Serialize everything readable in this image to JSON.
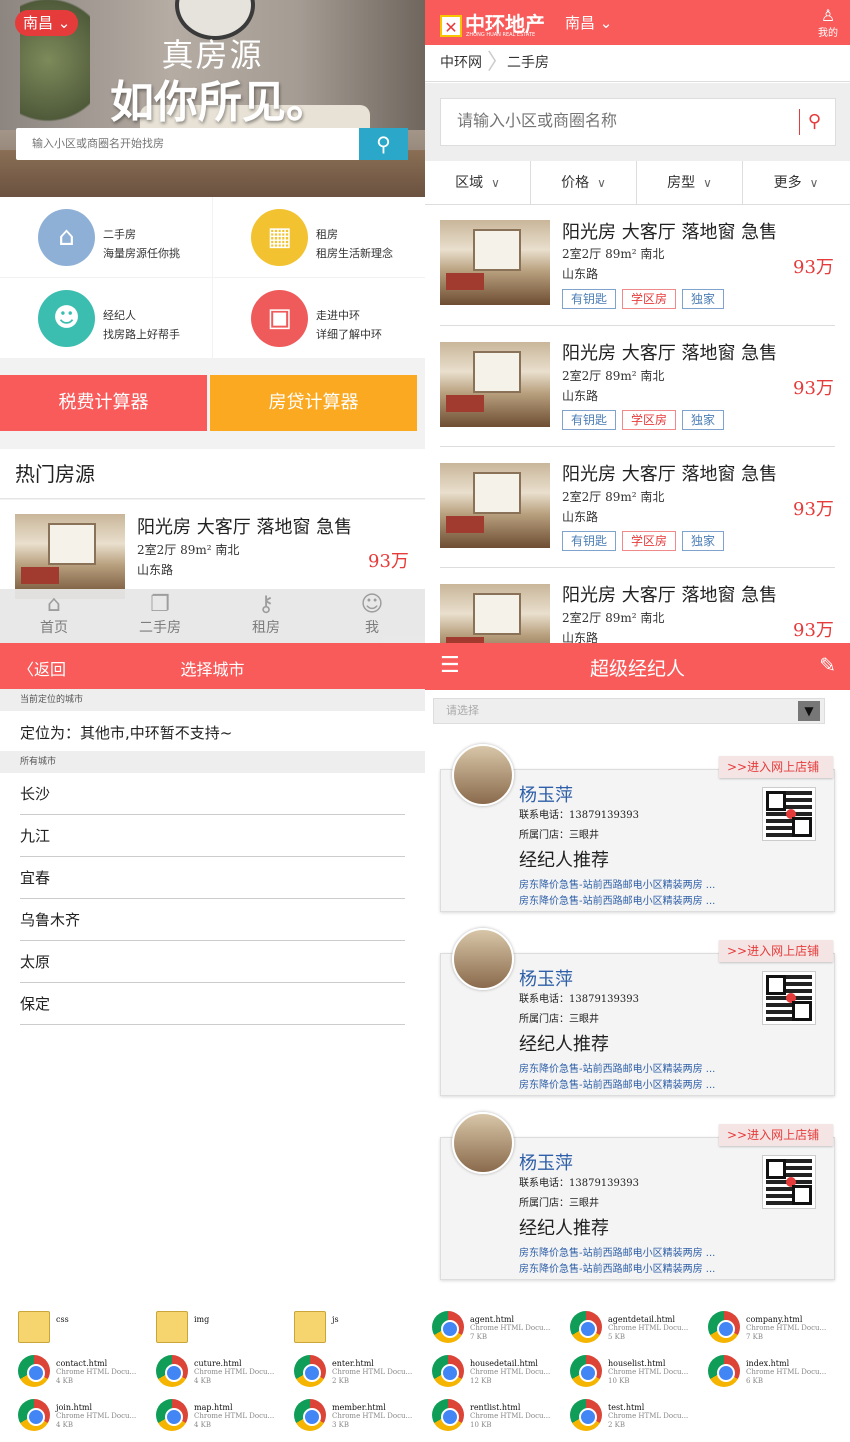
{
  "home": {
    "city": "南昌",
    "hero_line1": "真房源",
    "hero_line2": "如你所见。",
    "search_placeholder": "输入小区或商圈名开始找房",
    "features": [
      {
        "title": "二手房",
        "desc": "海量房源任你挑",
        "icon": "house-icon",
        "color": "#8fb0d6"
      },
      {
        "title": "租房",
        "desc": "租房生活新理念",
        "icon": "building-icon",
        "color": "#f2c230"
      },
      {
        "title": "经纪人",
        "desc": "找房路上好帮手",
        "icon": "person-icon",
        "color": "#3bbdb0"
      },
      {
        "title": "走进中环",
        "desc": "详细了解中环",
        "icon": "gallery-icon",
        "color": "#ef5b5b"
      }
    ],
    "tax_calc": "税费计算器",
    "loan_calc": "房贷计算器",
    "hot_title": "热门房源",
    "tabs": [
      "首页",
      "二手房",
      "租房",
      "我"
    ]
  },
  "listing": {
    "title": "阳光房 大客厅 落地窗 急售",
    "spec": "2室2厅 89m² 南北",
    "road": "山东路",
    "price": "93万",
    "tags": [
      "有钥匙",
      "学区房",
      "独家"
    ]
  },
  "list_page": {
    "logo_cn": "中环地产",
    "logo_en": "ZHONG HUAN REAL ESTATE",
    "city": "南昌",
    "me": "我的",
    "crumb1": "中环网",
    "crumb2": "二手房",
    "search_placeholder": "请输入小区或商圈名称",
    "filters": [
      "区域",
      "价格",
      "房型",
      "更多"
    ]
  },
  "city_page": {
    "back": "返回",
    "title": "选择城市",
    "current_label": "当前定位的城市",
    "located": "定位为：其他市,中环暂不支持~",
    "all_label": "所有城市",
    "cities": [
      "长沙",
      "九江",
      "宜春",
      "乌鲁木齐",
      "太原",
      "保定"
    ]
  },
  "agent_page": {
    "title": "超级经纪人",
    "select_placeholder": "请选择",
    "shop_link": ">>进入网上店铺",
    "name": "杨玉萍",
    "phone": "联系电话：13879139393",
    "store": "所属门店：三眼井",
    "recommend": "经纪人推荐",
    "link": "房东降价急售-站前西路邮电小区精装两房 ..."
  },
  "files": [
    {
      "name": "css",
      "type": "",
      "size": "",
      "kind": "folder"
    },
    {
      "name": "img",
      "type": "",
      "size": "",
      "kind": "folder"
    },
    {
      "name": "js",
      "type": "",
      "size": "",
      "kind": "folder"
    },
    {
      "name": "agent.html",
      "type": "Chrome HTML Docu...",
      "size": "7 KB",
      "kind": "chrome"
    },
    {
      "name": "agentdetail.html",
      "type": "Chrome HTML Docu...",
      "size": "5 KB",
      "kind": "chrome"
    },
    {
      "name": "company.html",
      "type": "Chrome HTML Docu...",
      "size": "7 KB",
      "kind": "chrome"
    },
    {
      "name": "contact.html",
      "type": "Chrome HTML Docu...",
      "size": "4 KB",
      "kind": "chrome"
    },
    {
      "name": "cuture.html",
      "type": "Chrome HTML Docu...",
      "size": "4 KB",
      "kind": "chrome"
    },
    {
      "name": "enter.html",
      "type": "Chrome HTML Docu...",
      "size": "2 KB",
      "kind": "chrome"
    },
    {
      "name": "housedetail.html",
      "type": "Chrome HTML Docu...",
      "size": "12 KB",
      "kind": "chrome"
    },
    {
      "name": "houselist.html",
      "type": "Chrome HTML Docu...",
      "size": "10 KB",
      "kind": "chrome"
    },
    {
      "name": "index.html",
      "type": "Chrome HTML Docu...",
      "size": "6 KB",
      "kind": "chrome"
    },
    {
      "name": "join.html",
      "type": "Chrome HTML Docu...",
      "size": "4 KB",
      "kind": "chrome"
    },
    {
      "name": "map.html",
      "type": "Chrome HTML Docu...",
      "size": "4 KB",
      "kind": "chrome"
    },
    {
      "name": "member.html",
      "type": "Chrome HTML Docu...",
      "size": "3 KB",
      "kind": "chrome"
    },
    {
      "name": "rentlist.html",
      "type": "Chrome HTML Docu...",
      "size": "10 KB",
      "kind": "chrome"
    },
    {
      "name": "test.html",
      "type": "Chrome HTML Docu...",
      "size": "2 KB",
      "kind": "chrome"
    }
  ]
}
